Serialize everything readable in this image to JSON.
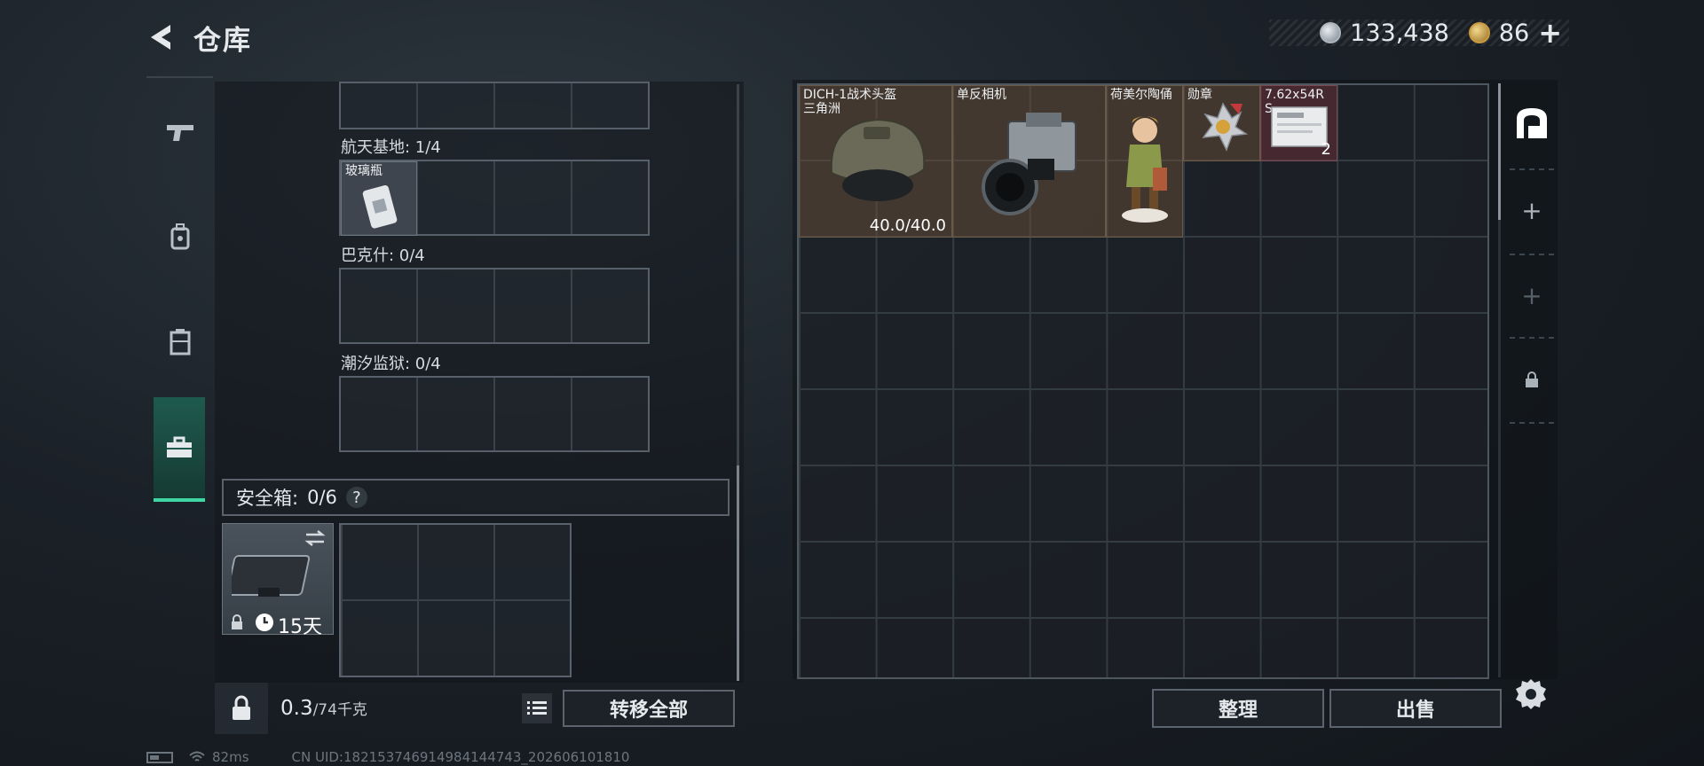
{
  "header": {
    "title": "仓库",
    "currency": {
      "silver": "133,438",
      "gold": "86",
      "add_label": "+"
    }
  },
  "left_nav": {
    "items": [
      {
        "name": "firearms",
        "icon": "gun-icon",
        "active": false
      },
      {
        "name": "equipment",
        "icon": "backpack-icon",
        "active": false
      },
      {
        "name": "storage-container",
        "icon": "container-icon",
        "active": false
      },
      {
        "name": "briefcase",
        "icon": "briefcase-icon",
        "active": true
      }
    ]
  },
  "maps": [
    {
      "label": "航天基地: 1/4",
      "item": "玻璃瓶"
    },
    {
      "label": "巴克什: 0/4"
    },
    {
      "label": "潮汐监狱: 0/4"
    }
  ],
  "safe_box": {
    "label": "安全箱:",
    "count": "0/6",
    "help": "?",
    "duration": "15天"
  },
  "weight": {
    "current": "0.3",
    "max": "/74千克"
  },
  "actions": {
    "transfer_all": "转移全部",
    "sort": "整理",
    "sell": "出售"
  },
  "storage_items": [
    {
      "name": "DICH-1战术头盔\n三角洲",
      "durability": "40.0/40.0",
      "color": "brown"
    },
    {
      "name": "单反相机",
      "color": "brown"
    },
    {
      "name": "荷美尔陶俑",
      "color": "brown"
    },
    {
      "name": "勋章",
      "color": "brown"
    },
    {
      "name": "7.62x54R\nS",
      "count": "2",
      "color": "red"
    }
  ],
  "right_nav": {
    "items": [
      {
        "icon": "warehouse-icon",
        "label": ""
      },
      {
        "icon": "plus-icon",
        "label": "+"
      },
      {
        "icon": "plus-icon",
        "label": "+"
      },
      {
        "icon": "lock-icon",
        "label": ""
      }
    ]
  },
  "status_bar": {
    "ping": "82ms",
    "uid": "CN UID:182153746914984144743_202606101810"
  }
}
